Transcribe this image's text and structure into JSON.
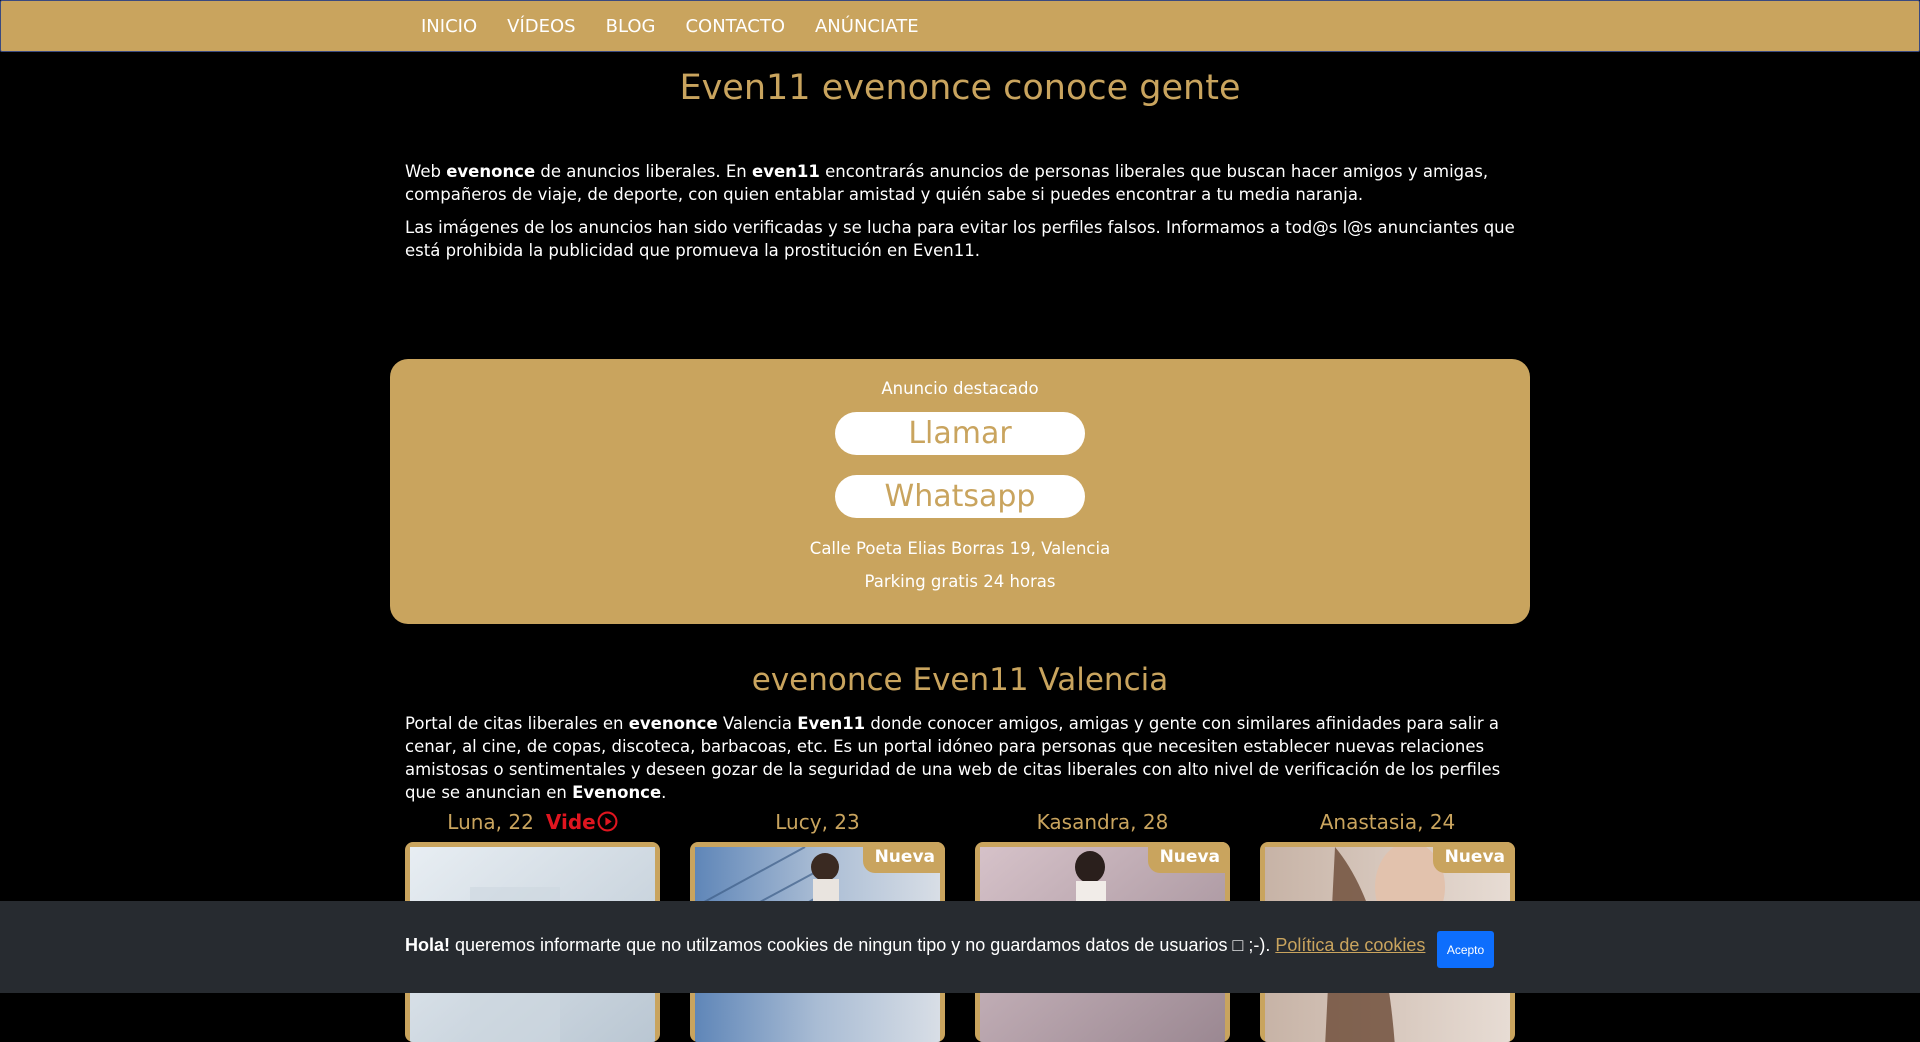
{
  "nav": {
    "items": [
      "INICIO",
      "VÍDEOS",
      "BLOG",
      "CONTACTO",
      "ANÚNCIATE"
    ]
  },
  "header": {
    "title": "Even11 evenonce conoce gente"
  },
  "intro": {
    "p1_a": "Web ",
    "p1_b": "evenonce",
    "p1_c": " de anuncios liberales. En ",
    "p1_d": "even11",
    "p1_e": " encontrarás anuncios de personas liberales que buscan hacer amigos y amigas, compañeros de viaje, de deporte, con quien entablar amistad y quién sabe si puedes encontrar a tu media naranja.",
    "p2": "Las imágenes de los anuncios han sido verificadas y se lucha para evitar los perfiles falsos. Informamos a tod@s l@s anunciantes que está prohibida la publicidad que promueva la prostitución en Even11."
  },
  "featured": {
    "label": "Anuncio destacado",
    "call_label": "Llamar",
    "whatsapp_label": "Whatsapp",
    "address": "Calle Poeta Elias Borras 19, Valencia",
    "parking": "Parking gratis 24 horas"
  },
  "section": {
    "title": "evenonce Even11 Valencia",
    "d1": "Portal de citas liberales en ",
    "d2": "evenonce",
    "d3": " Valencia ",
    "d4": "Even11",
    "d5": " donde conocer amigos, amigas y gente con similares afinidades para salir a cenar, al cine, de copas, discoteca, barbacoas, etc. Es un portal idóneo para personas que necesiten establecer nuevas relaciones amistosas o sentimentales y deseen gozar de la seguridad de una web de citas liberales con alto nivel de verificación de los perfiles que se anuncian en ",
    "d6": "Evenonce",
    "d7": "."
  },
  "cards": [
    {
      "name": "Luna, 22",
      "video_label": "Vide",
      "badge": ""
    },
    {
      "name": "Lucy, 23",
      "video_label": "",
      "badge": "Nueva"
    },
    {
      "name": "Kasandra, 28",
      "video_label": "",
      "badge": "Nueva"
    },
    {
      "name": "Anastasia, 24",
      "video_label": "",
      "badge": "Nueva"
    }
  ],
  "cookie": {
    "greeting": "Hola!",
    "text": " queremos informarte que no utilzamos cookies de ningun tipo y no guardamos datos de usuarios □ ;-). ",
    "link": "Política de cookies",
    "accept": "Acepto"
  },
  "colors": {
    "gold": "#c9a45e",
    "black": "#000000",
    "cookie_bg": "#272b30",
    "accept_blue": "#0d6efd",
    "video_red": "#e0151f"
  }
}
